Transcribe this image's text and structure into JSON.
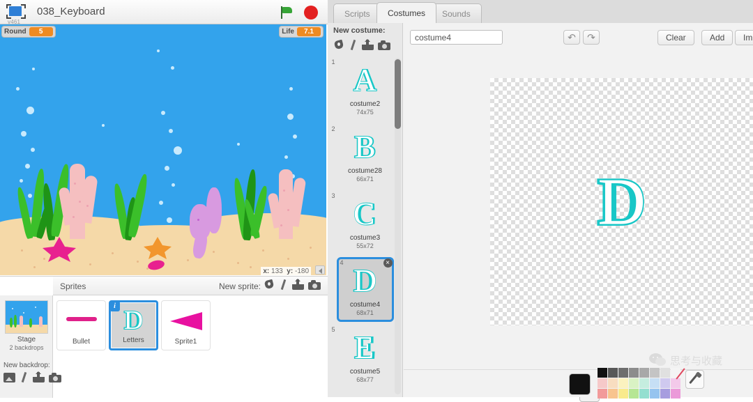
{
  "stage_header": {
    "project_title": "038_Keyboard",
    "version_label": "v461",
    "present_icon": "fullscreen-icon",
    "green_flag_icon": "green-flag-icon",
    "stop_icon": "stop-sign-icon"
  },
  "stage": {
    "watchers": [
      {
        "label": "Round",
        "value": "5"
      },
      {
        "label": "Life",
        "value": "7.1"
      }
    ],
    "coords": {
      "x_label": "x:",
      "x_value": "133",
      "y_label": "y:",
      "y_value": "-180"
    },
    "collapse_icon": "collapse-arrow-icon",
    "background_color": "#33a3ec",
    "sand_color": "#f5d9a8"
  },
  "sprite_pane": {
    "sprites_label": "Sprites",
    "new_sprite_label": "New sprite:",
    "new_sprite_icons": [
      "paint-new-icon",
      "brush-icon",
      "upload-icon",
      "camera-icon"
    ],
    "stage_tile": {
      "name": "Stage",
      "subtitle": "2 backdrops",
      "new_backdrop_label": "New backdrop:",
      "new_backdrop_icons": [
        "image-icon",
        "brush-icon",
        "upload-icon",
        "camera-icon"
      ]
    },
    "sprites": [
      {
        "name": "Bullet",
        "selected": false,
        "badge": ""
      },
      {
        "name": "Letters",
        "selected": true,
        "badge": "i"
      },
      {
        "name": "Sprite1",
        "selected": false,
        "badge": ""
      }
    ]
  },
  "tabs": [
    {
      "label": "Scripts",
      "active": false
    },
    {
      "label": "Costumes",
      "active": true
    },
    {
      "label": "Sounds",
      "active": false
    }
  ],
  "costume_panel": {
    "new_costume_label": "New costume:",
    "new_costume_icons": [
      "paint-new-icon",
      "brush-icon",
      "upload-icon",
      "camera-icon"
    ],
    "delete_badge": "×",
    "costumes": [
      {
        "num": "1",
        "name": "costume2",
        "size": "74x75",
        "letter": "A",
        "selected": false
      },
      {
        "num": "2",
        "name": "costume28",
        "size": "66x71",
        "letter": "B",
        "selected": false
      },
      {
        "num": "3",
        "name": "costume3",
        "size": "55x72",
        "letter": "C",
        "selected": false
      },
      {
        "num": "4",
        "name": "costume4",
        "size": "68x71",
        "letter": "D",
        "selected": true
      },
      {
        "num": "5",
        "name": "costume5",
        "size": "68x77",
        "letter": "E",
        "selected": false
      }
    ]
  },
  "paint_editor": {
    "costume_name_value": "costume4",
    "undo_icon": "undo-arrow-icon",
    "redo_icon": "redo-arrow-icon",
    "clear_label": "Clear",
    "add_label": "Add",
    "import_label": "Impor",
    "canvas_letter": "D",
    "canvas_letter_color": "#18c7c7",
    "fill_color": "#111111",
    "palette_row1": [
      "#111111",
      "#585858",
      "#6e6e6e",
      "#8c8c8c",
      "#a8a8a8",
      "#c4c4c4",
      "#e0e0e0",
      "#f4f4f4"
    ],
    "palette_row2": [
      "#f6c9c9",
      "#f8ddc0",
      "#fbf2bf",
      "#d9f2c4",
      "#c5eddf",
      "#c6dff5",
      "#cfc9ef",
      "#f3c9ea"
    ],
    "palette_row3": [
      "#f29a9a",
      "#f8c48e",
      "#f9ea8c",
      "#b6e694",
      "#94dfd0",
      "#96c4ef",
      "#a79ddf",
      "#eb9ad9"
    ],
    "no_color_icon": "no-color-slash-icon",
    "eyedropper_icon": "eyedropper-icon"
  },
  "watermark": {
    "icon": "wechat-icon",
    "text": "思考与收藏"
  }
}
